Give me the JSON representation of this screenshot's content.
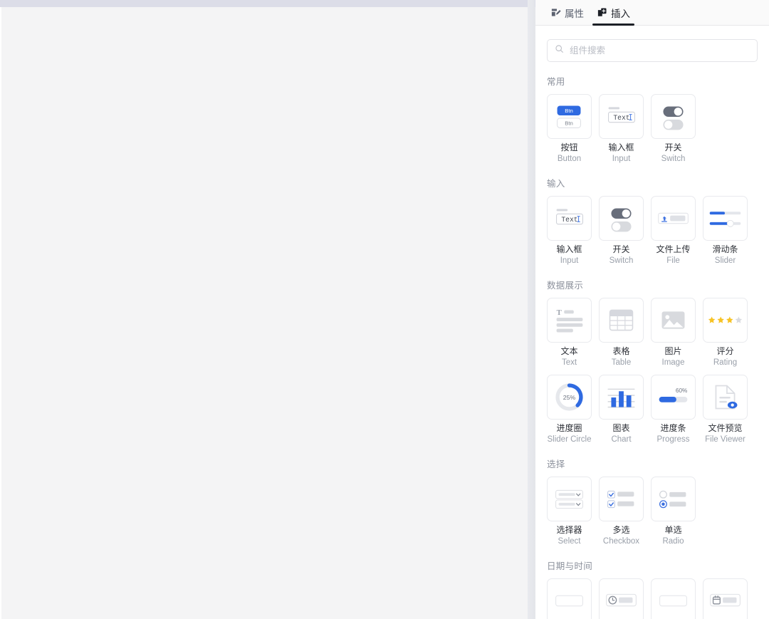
{
  "tabs": [
    {
      "label": "属性",
      "icon": "document-edit-icon",
      "active": false
    },
    {
      "label": "插入",
      "icon": "add-layer-icon",
      "active": true
    }
  ],
  "search": {
    "placeholder": "组件搜索",
    "value": "",
    "icon": "search-icon"
  },
  "colors": {
    "accent_blue": "#2f6ae1",
    "star_gold": "#f7c325",
    "panel_border": "#e9eaee",
    "text_primary": "#2d3037",
    "text_secondary": "#9aa0aa",
    "section_title": "#8c919c"
  },
  "sections": [
    {
      "title": "常用",
      "items": [
        {
          "cn": "按钮",
          "en": "Button",
          "icon": "button-thumb"
        },
        {
          "cn": "输入框",
          "en": "Input",
          "icon": "input-thumb"
        },
        {
          "cn": "开关",
          "en": "Switch",
          "icon": "switch-thumb"
        }
      ]
    },
    {
      "title": "输入",
      "items": [
        {
          "cn": "输入框",
          "en": "Input",
          "icon": "input-thumb"
        },
        {
          "cn": "开关",
          "en": "Switch",
          "icon": "switch-thumb"
        },
        {
          "cn": "文件上传",
          "en": "File",
          "icon": "file-upload-thumb"
        },
        {
          "cn": "滑动条",
          "en": "Slider",
          "icon": "slider-thumb"
        }
      ]
    },
    {
      "title": "数据展示",
      "items": [
        {
          "cn": "文本",
          "en": "Text",
          "icon": "text-thumb"
        },
        {
          "cn": "表格",
          "en": "Table",
          "icon": "table-thumb"
        },
        {
          "cn": "图片",
          "en": "Image",
          "icon": "image-thumb"
        },
        {
          "cn": "评分",
          "en": "Rating",
          "icon": "rating-thumb"
        },
        {
          "cn": "进度圈",
          "en": "Slider Circle",
          "icon": "progress-circle-thumb",
          "value": "25%"
        },
        {
          "cn": "图表",
          "en": "Chart",
          "icon": "chart-thumb"
        },
        {
          "cn": "进度条",
          "en": "Progress",
          "icon": "progress-bar-thumb",
          "value": "60%"
        },
        {
          "cn": "文件预览",
          "en": "File Viewer",
          "icon": "file-viewer-thumb"
        }
      ]
    },
    {
      "title": "选择",
      "items": [
        {
          "cn": "选择器",
          "en": "Select",
          "icon": "select-thumb"
        },
        {
          "cn": "多选",
          "en": "Checkbox",
          "icon": "checkbox-thumb"
        },
        {
          "cn": "单选",
          "en": "Radio",
          "icon": "radio-thumb"
        }
      ]
    },
    {
      "title": "日期与时间",
      "items": [
        {
          "cn": "",
          "en": "",
          "icon": "date-thumb"
        },
        {
          "cn": "",
          "en": "",
          "icon": "time-thumb"
        },
        {
          "cn": "",
          "en": "",
          "icon": "daterange-thumb"
        },
        {
          "cn": "",
          "en": "",
          "icon": "calendar-thumb"
        }
      ]
    }
  ],
  "thumb_text": {
    "btn_primary": "Btn",
    "btn_secondary": "Btn",
    "input_text": "Text",
    "text_t": "T",
    "progress_circle": "25%",
    "progress_bar": "60%"
  }
}
